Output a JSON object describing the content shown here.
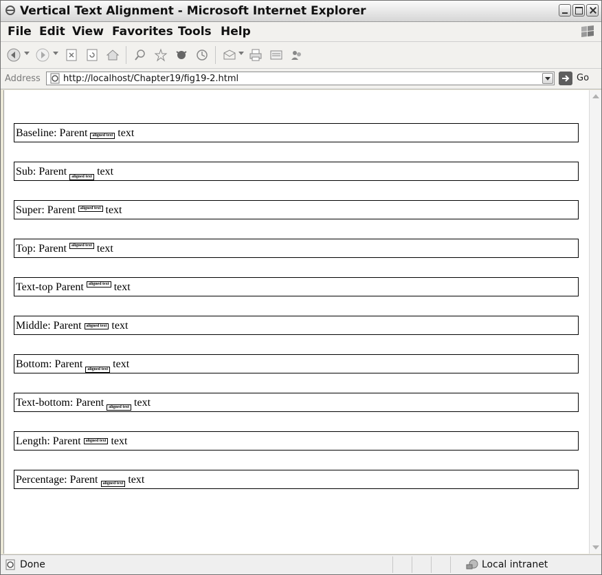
{
  "window": {
    "title": "Vertical Text Alignment - Microsoft Internet Explorer"
  },
  "menu": [
    "File",
    "Edit",
    "View",
    "Favorites",
    "Tools",
    "Help"
  ],
  "toolbar_icons": [
    "back-icon",
    "forward-icon",
    "stop-icon",
    "refresh-icon",
    "home-icon",
    "search-icon",
    "favorites-icon",
    "media-icon",
    "history-icon",
    "mail-icon",
    "print-icon",
    "edit-icon",
    "messenger-icon"
  ],
  "address": {
    "label": "Address",
    "url": "http://localhost/Chapter19/fig19-2.html",
    "go": "Go"
  },
  "demos": [
    {
      "label": "Baseline: Parent",
      "inner": "aligned text",
      "after": "text",
      "align": "baseline"
    },
    {
      "label": "Sub: Parent",
      "inner": "aligned text",
      "after": "text",
      "align": "sub"
    },
    {
      "label": "Super: Parent",
      "inner": "aligned text",
      "after": "text",
      "align": "super"
    },
    {
      "label": "Top: Parent",
      "inner": "aligned text",
      "after": "text",
      "align": "top"
    },
    {
      "label": "Text-top Parent",
      "inner": "aligned text",
      "after": "text",
      "align": "text-top"
    },
    {
      "label": "Middle: Parent",
      "inner": "aligned text",
      "after": "text",
      "align": "middle"
    },
    {
      "label": "Bottom: Parent",
      "inner": "aligned text",
      "after": "text",
      "align": "bottom"
    },
    {
      "label": "Text-bottom: Parent",
      "inner": "aligned text",
      "after": "text",
      "align": "text-bottom"
    },
    {
      "label": "Length: Parent",
      "inner": "aligned text",
      "after": "text",
      "align": "length"
    },
    {
      "label": "Percentage: Parent",
      "inner": "aligned text",
      "after": "text",
      "align": "percentage"
    }
  ],
  "status": {
    "text": "Done",
    "zone": "Local intranet"
  }
}
